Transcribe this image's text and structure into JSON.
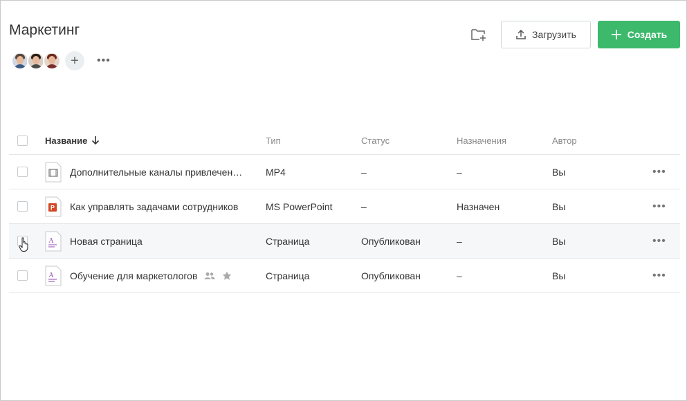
{
  "page": {
    "title": "Маркетинг"
  },
  "header": {
    "upload_label": "Загрузить",
    "create_label": "Создать",
    "more_members": "•••",
    "add_member": "+"
  },
  "colors": {
    "accent": "#3cb96b",
    "border": "#e4e6e8",
    "muted": "#888888"
  },
  "table": {
    "columns": {
      "name": "Название",
      "type": "Тип",
      "status": "Статус",
      "assignments": "Назначения",
      "author": "Автор"
    },
    "more": "•••",
    "rows": [
      {
        "name": "Дополнительные каналы привлечения клиентов",
        "type": "MP4",
        "status": "–",
        "assignments": "–",
        "author": "Вы",
        "icon": "video-file-icon"
      },
      {
        "name": "Как управлять задачами сотрудников",
        "type": "MS PowerPoint",
        "status": "–",
        "assignments": "Назначен",
        "author": "Вы",
        "icon": "powerpoint-file-icon"
      },
      {
        "name": "Новая страница",
        "type": "Страница",
        "status": "Опубликован",
        "assignments": "–",
        "author": "Вы",
        "icon": "page-file-icon"
      },
      {
        "name": "Обучение для маркетологов",
        "type": "Страница",
        "status": "Опубликован",
        "assignments": "–",
        "author": "Вы",
        "icon": "page-file-icon"
      }
    ]
  }
}
